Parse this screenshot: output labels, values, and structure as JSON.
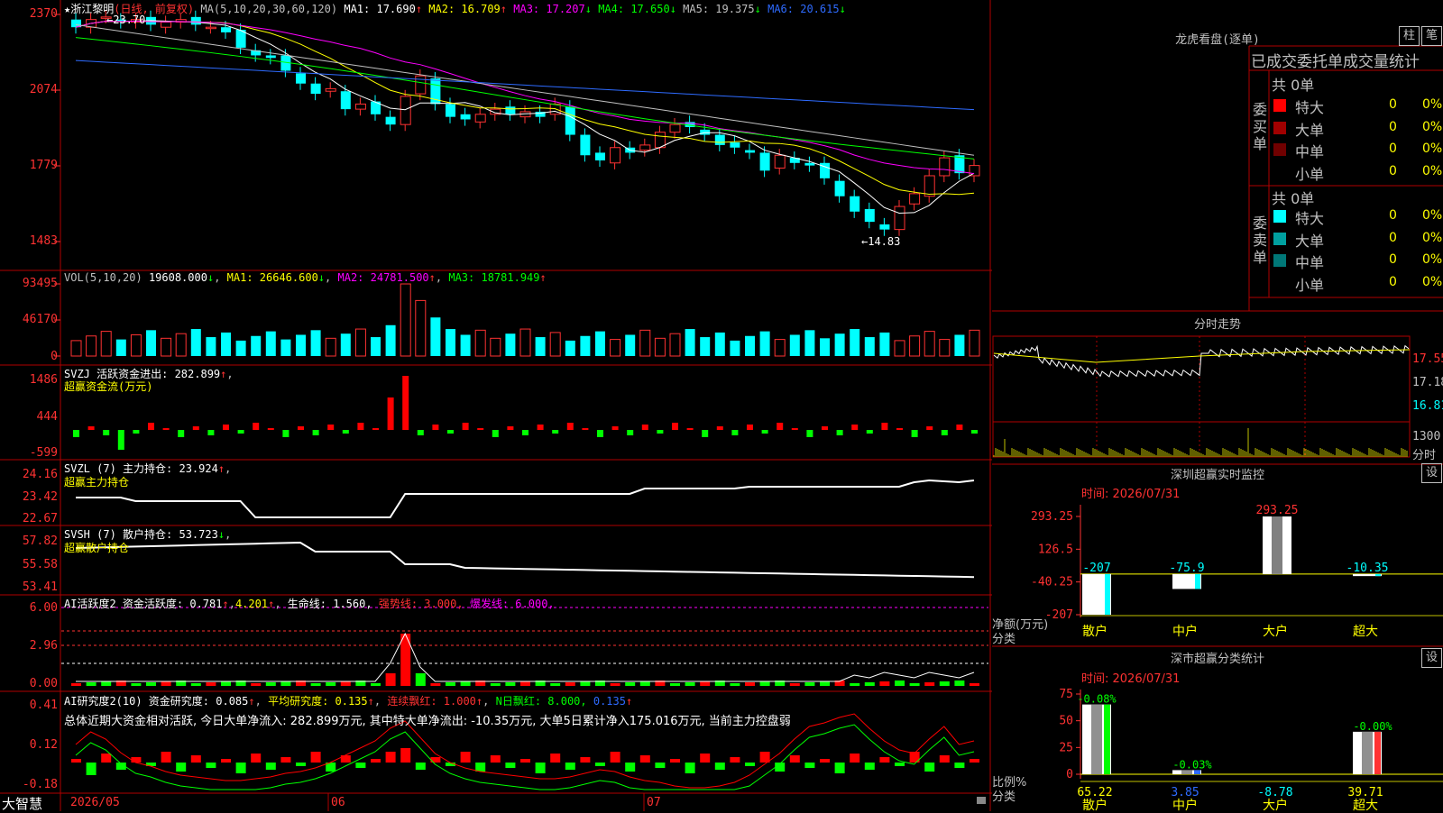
{
  "stock": {
    "name_star": "★",
    "name": "浙江黎明",
    "mode": "(日线, 前复权)",
    "ma_params": "MA(5,10,20,30,60,120)",
    "ma1": "MA1: 17.690",
    "ma2": "MA2: 16.709",
    "ma3": "MA3: 17.207",
    "ma4": "MA4: 17.650",
    "ma5": "MA5: 19.375",
    "ma6": "MA6: 20.615",
    "ma1_arrow": "↑",
    "ma2_arrow": "↑",
    "ma3_arrow": "↓",
    "ma4_arrow": "↓",
    "ma5_arrow": "↓",
    "ma6_arrow": "↓",
    "high_label": "23.70",
    "low_label": "14.83"
  },
  "price_axis": [
    "2370",
    "2074",
    "1779",
    "1483"
  ],
  "vol": {
    "title": "VOL(5,10,20)",
    "value": "19608.000",
    "ma1": "MA1: 26646.600",
    "ma2": "MA2: 24781.500",
    "ma3": "MA3: 18781.949",
    "axis": [
      "93495",
      "46170",
      "0"
    ]
  },
  "svzj": {
    "title": "SVZJ  活跃资金进出: 282.899",
    "subtitle": "超赢资金流(万元)",
    "axis": [
      "1486",
      "444",
      "-599"
    ]
  },
  "svzl": {
    "title": "SVZL (7) 主力持仓: 23.924",
    "subtitle": "超赢主力持仓",
    "axis": [
      "24.16",
      "23.42",
      "22.67"
    ]
  },
  "svsh": {
    "title": "SVSH (7) 散户持仓: 53.723",
    "subtitle": "超赢散户持仓",
    "axis": [
      "57.82",
      "55.58",
      "53.41"
    ]
  },
  "ai1": {
    "title": "AI活跃度2 资金活跃度: 0.781",
    "v2": "4.201",
    "v3": "生命线: 1.560,",
    "v4": "强势线: 3.000,",
    "v5": "爆发线: 6.000,",
    "axis": [
      "6.00",
      "2.96",
      "0.00"
    ]
  },
  "ai2": {
    "title": "AI研究度2(10) 资金研究度: 0.085",
    "v2": "平均研究度: 0.135",
    "v3": "连续飘红: 1.000",
    "v4": "N日飘红: 8.000,",
    "v5": "0.135",
    "summary": "总体近期大资金相对活跃, 今日大单净流入: 282.899万元, 其中特大单净流出: -10.35万元, 大单5日累计净入175.016万元, 当前主力控盘弱",
    "axis": [
      "0.41",
      "0.12",
      "-0.18"
    ]
  },
  "bottom": {
    "brand": "大智慧",
    "dates": [
      "2026/05",
      "06",
      "07"
    ]
  },
  "right": {
    "longhu_title": "龙虎看盘(逐单)",
    "btn_col": "柱",
    "btn_pen": "笔",
    "tabs": "已成交委托单成交量统计",
    "buy_label": "委买单",
    "sell_label": "委卖单",
    "buy_total": "共 0单",
    "sell_total": "共 0单",
    "buy_rows": [
      {
        "label": "特大",
        "v": "0",
        "p": "0%",
        "color": "#ff0000"
      },
      {
        "label": "大单",
        "v": "0",
        "p": "0%",
        "color": "#a00000"
      },
      {
        "label": "中单",
        "v": "0",
        "p": "0%",
        "color": "#700000"
      },
      {
        "label": "小单",
        "v": "0",
        "p": "0%",
        "color": ""
      }
    ],
    "sell_rows": [
      {
        "label": "特大",
        "v": "0",
        "p": "0%",
        "color": "#00ffff"
      },
      {
        "label": "大单",
        "v": "0",
        "p": "0%",
        "color": "#00a0a0"
      },
      {
        "label": "中单",
        "v": "0",
        "p": "0%",
        "color": "#007878"
      },
      {
        "label": "小单",
        "v": "0",
        "p": "0%",
        "color": ""
      }
    ],
    "intraday_title": "分时走势",
    "intraday_axis": [
      "17.55",
      "17.18",
      "16.81",
      "1300",
      "分时"
    ],
    "monitor_title": "深圳超赢实时监控",
    "monitor_btn": "设",
    "monitor_time": "时间: 2026/07/31",
    "monitor_axis": [
      "293.25",
      "126.5",
      "-40.25",
      "-207"
    ],
    "monitor_ylabel": "净额(万元)",
    "monitor_xlabel": "分类",
    "classify_title": "深市超赢分类统计",
    "classify_btn": "设",
    "classify_time": "时间: 2026/07/31",
    "classify_axis": [
      "75",
      "50",
      "25",
      "0"
    ],
    "classify_ylabel": "比例%",
    "classify_xlabel": "分类"
  },
  "chart_data": [
    {
      "type": "bar",
      "title": "深圳超赢实时监控",
      "ylabel": "净额(万元)",
      "xlabel": "分类",
      "categories": [
        "散户",
        "中户",
        "大户",
        "超大"
      ],
      "values": [
        -207,
        -75.9,
        293.25,
        -10.35
      ],
      "value_labels": [
        "-207",
        "-75.9",
        "293.25",
        "-10.35"
      ],
      "ylim": [
        -207,
        293.25
      ]
    },
    {
      "type": "bar",
      "title": "深市超赢分类统计",
      "ylabel": "比例%",
      "xlabel": "分类",
      "categories": [
        "散户",
        "中户",
        "大户",
        "超大"
      ],
      "values": [
        65.22,
        3.85,
        -8.78,
        39.71
      ],
      "value_labels": [
        "65.22",
        "3.85",
        "-8.78",
        "39.71"
      ],
      "top_labels": [
        "-0.08%",
        "-0.03%",
        "",
        "-0.00%"
      ],
      "ylim": [
        0,
        75
      ]
    }
  ]
}
